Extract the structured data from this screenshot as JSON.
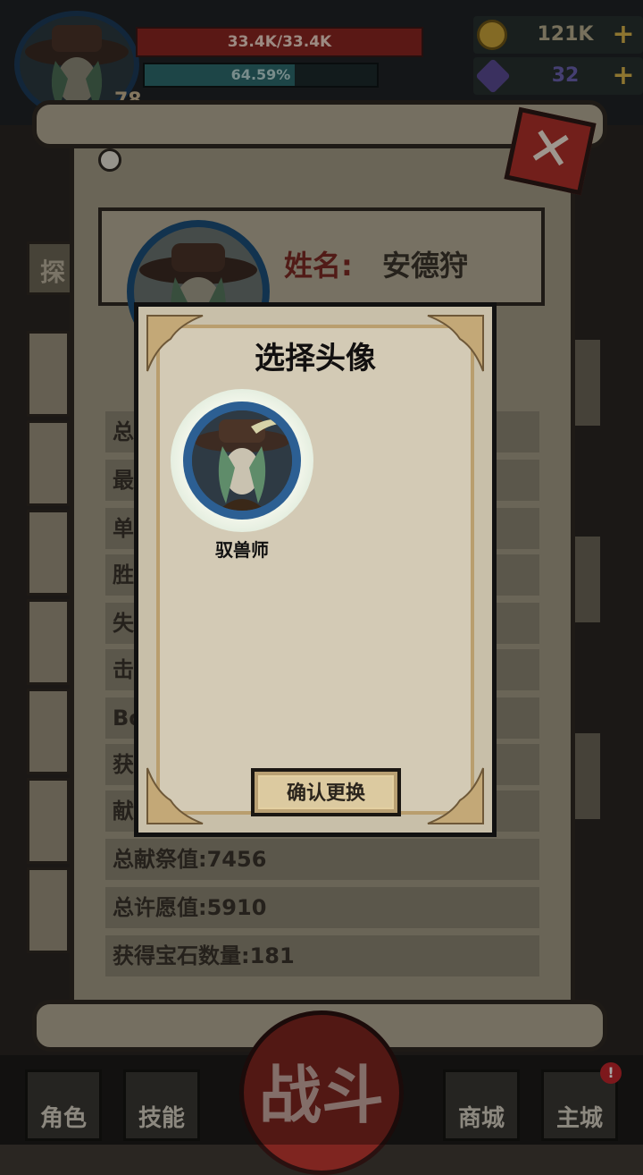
{
  "hud": {
    "hp_text": "33.4K/33.4K",
    "xp_text": "64.59%",
    "xp_percent": 64.59,
    "level_text": "78",
    "resources": [
      {
        "icon": "gold-coin-icon",
        "value": "121K",
        "plus": "+"
      },
      {
        "icon": "purple-gem-icon",
        "value": "32",
        "plus": "+"
      }
    ]
  },
  "profile": {
    "name_label": "姓名:",
    "name_value": "安德狩"
  },
  "side_tabs": [
    "探"
  ],
  "stats": [
    {
      "label": "总"
    },
    {
      "label": "最"
    },
    {
      "label": "单"
    },
    {
      "label": "胜"
    },
    {
      "label": "失"
    },
    {
      "label": "击"
    },
    {
      "label": "Bo"
    },
    {
      "label": "获"
    },
    {
      "label": "献"
    },
    {
      "label": "总献祭值:7456"
    },
    {
      "label": "总许愿值:5910"
    },
    {
      "label": "获得宝石数量:181"
    }
  ],
  "close_button": {
    "symbol": "✕"
  },
  "dialog": {
    "title": "选择头像",
    "avatar_caption": "驭兽师",
    "confirm_label": "确认更换"
  },
  "nav": {
    "character": "角色",
    "skills": "技能",
    "battle": "战斗",
    "shop": "商城",
    "main_city": "主城",
    "alert": "!"
  },
  "colors": {
    "hp_red": "#8a2621",
    "xp_teal": "#2d6b6e",
    "parchment": "#a39b86",
    "dialog_bg": "#d3cab5",
    "avatar_ring_blue": "#2c5f93",
    "close_red": "#b0302a"
  }
}
